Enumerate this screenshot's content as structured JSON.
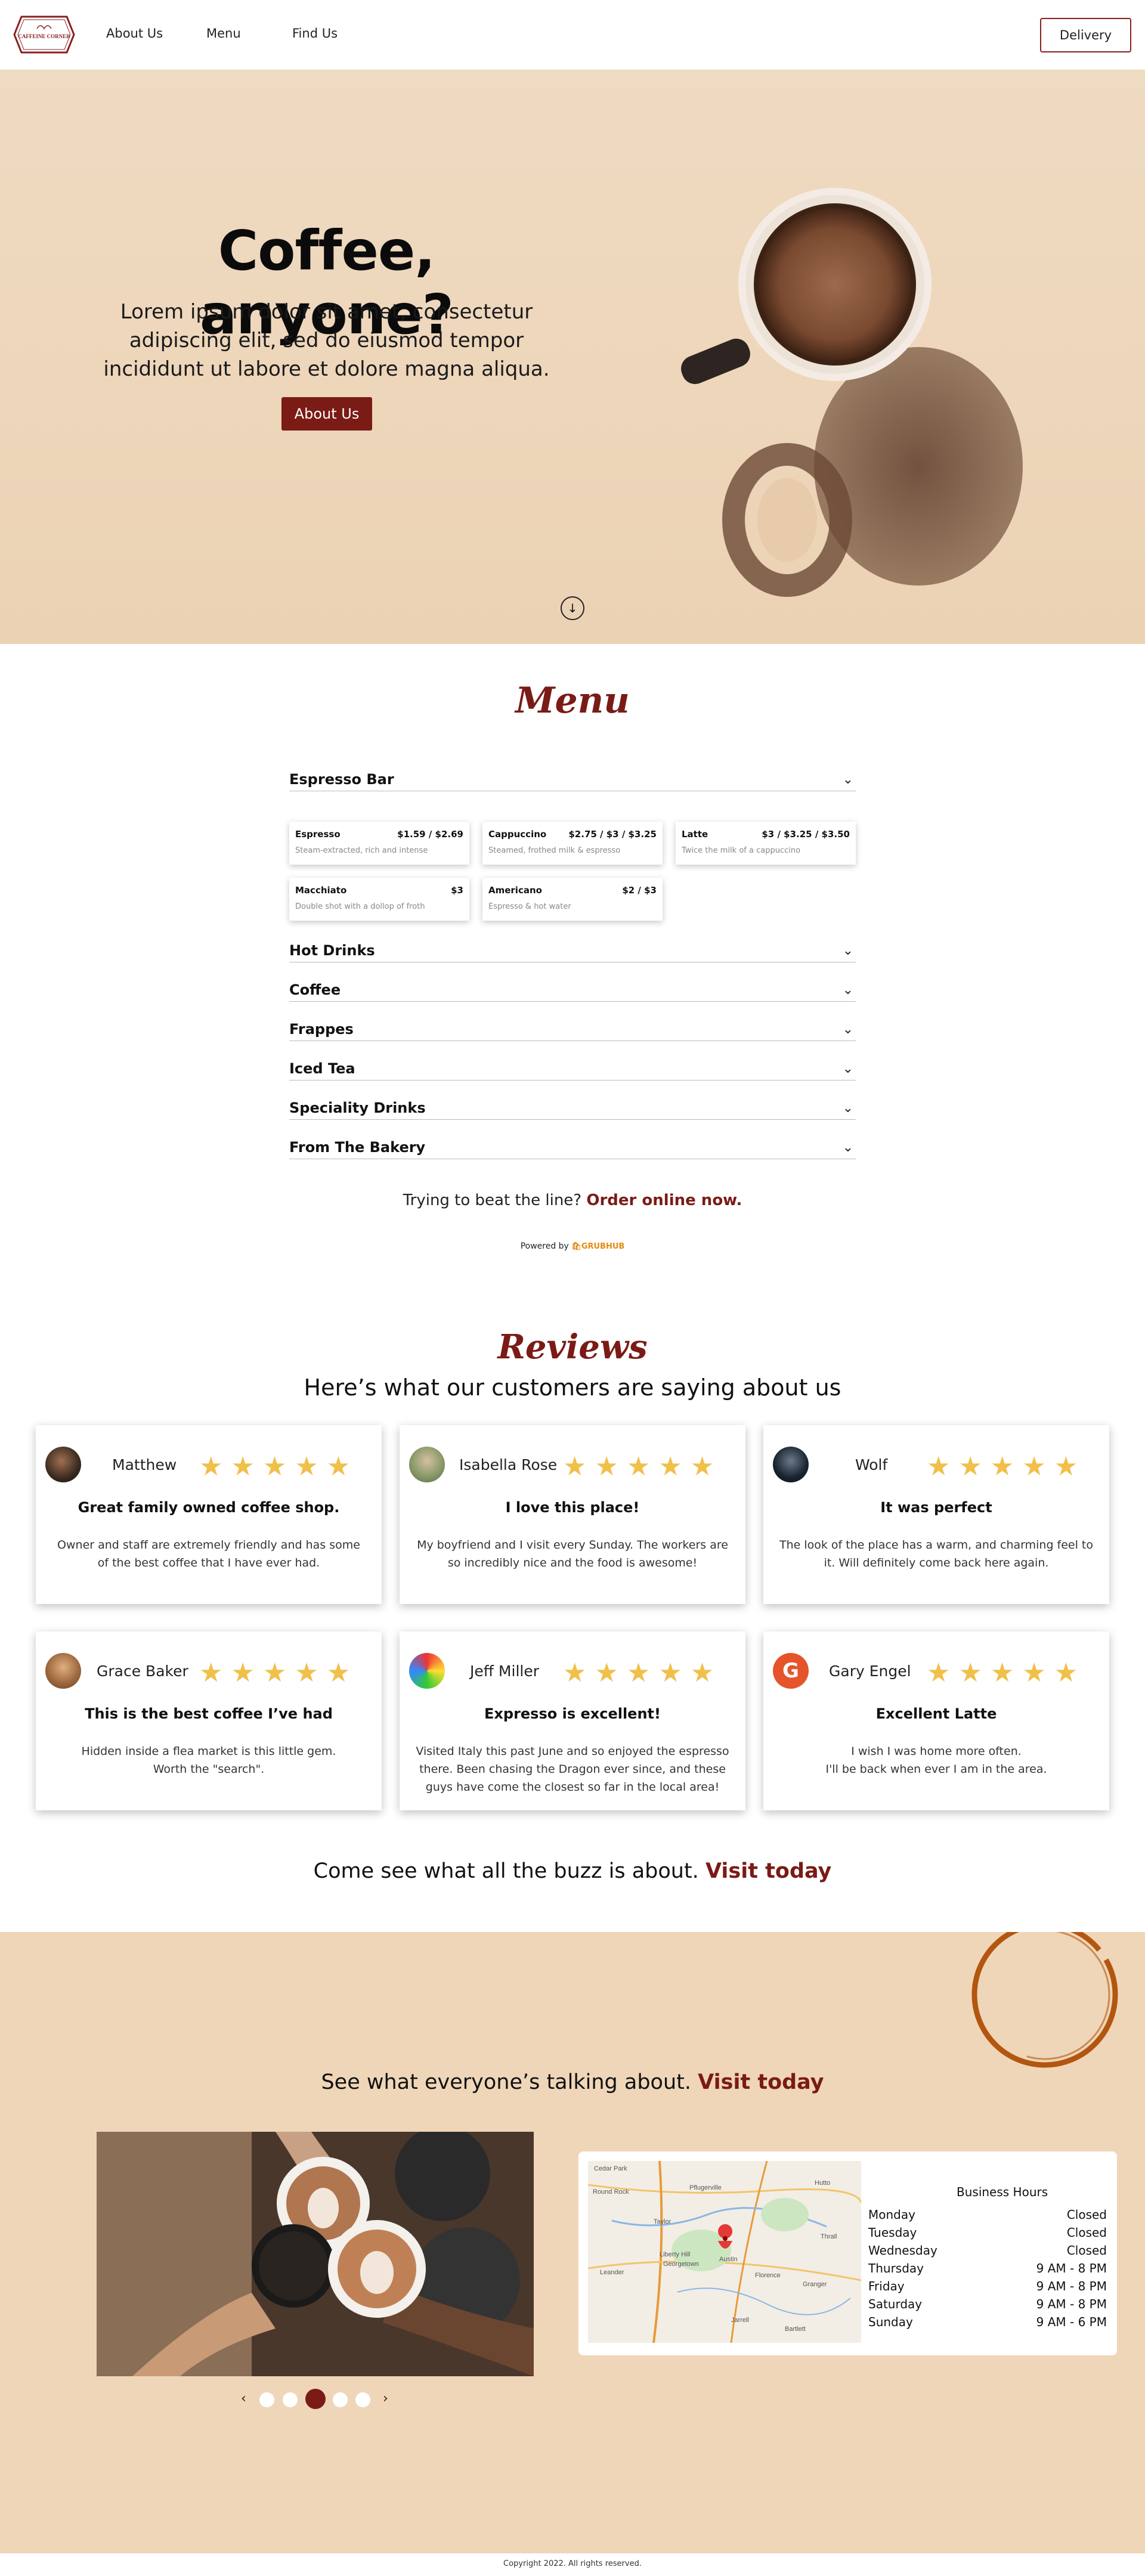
{
  "nav": {
    "logo_text": "CAFFEINE CORNER",
    "links": [
      "About Us",
      "Menu",
      "Find Us"
    ],
    "delivery_label": "Delivery"
  },
  "hero": {
    "title": "Coffee, anyone?",
    "text": "Lorem ipsum dolor sit amet, consectetur adipiscing elit, sed do eiusmod tempor incididunt ut labore et dolore magna aliqua.",
    "button_label": "About Us",
    "scroll_icon": "arrow-down-circle-icon"
  },
  "menu": {
    "title": "Menu",
    "open_category": "Espresso Bar",
    "items": [
      {
        "name": "Espresso",
        "price": "$1.59 / $2.69",
        "desc": "Steam-extracted, rich and intense"
      },
      {
        "name": "Cappuccino",
        "price": "$2.75 / $3 / $3.25",
        "desc": "Steamed, frothed milk & espresso"
      },
      {
        "name": "Latte",
        "price": "$3 / $3.25 / $3.50",
        "desc": "Twice the milk of a cappuccino"
      },
      {
        "name": "Macchiato",
        "price": "$3",
        "desc": "Double shot with a dollop of froth"
      },
      {
        "name": "Americano",
        "price": "$2 / $3",
        "desc": "Espresso & hot water"
      }
    ],
    "categories": [
      "Hot Drinks",
      "Coffee",
      "Frappes",
      "Iced Tea",
      "Speciality Drinks",
      "From The Bakery"
    ],
    "order_text": "Trying to beat the line?",
    "order_link": "Order online now.",
    "powered_text": "Powered by",
    "powered_brand": "GRUBHUB"
  },
  "reviews": {
    "title": "Reviews",
    "subtitle": "Here’s what our customers are saying about us",
    "stars": "★★★★★",
    "items": [
      {
        "name": "Matthew",
        "headline": "Great family owned coffee shop.",
        "body": "Owner and staff are extremely friendly and has some of the best coffee that I have ever had."
      },
      {
        "name": "Isabella Rose",
        "headline": "I love this place!",
        "body": "My boyfriend and I visit every Sunday. The workers are so incredibly nice and the food is awesome!"
      },
      {
        "name": "Wolf",
        "headline": "It was perfect",
        "body": "The look of the place has a warm, and charming feel to it. Will definitely come back here again."
      },
      {
        "name": "Grace Baker",
        "headline": "This is the best coffee I’ve had",
        "body": "Hidden inside a flea market is this little gem.\nWorth the \"search\"."
      },
      {
        "name": "Jeff Miller",
        "headline": "Expresso is excellent!",
        "body": "Visited Italy this past June and so enjoyed the espresso there.  Been chasing the Dragon ever since, and these guys have come the closest so far in the local area!"
      },
      {
        "name": "Gary Engel",
        "avatar_letter": "G",
        "headline": "Excellent Latte",
        "body": "I wish I was home more often.\nI'll be back when ever I am in the area."
      }
    ],
    "buzz_text": "Come see what all the buzz is about.",
    "buzz_link": "Visit today"
  },
  "visit": {
    "title_text": "See what everyone’s talking about.",
    "title_link": "Visit today",
    "carousel": {
      "prev": "‹",
      "next": "›",
      "slides": 5,
      "active_slide": 3
    },
    "map_labels": [
      "Cedar Park",
      "Round Rock",
      "Pflugerville",
      "Hutto",
      "Taylor",
      "Leander",
      "Liberty Hill",
      "Georgetown",
      "Florence",
      "Jarrell",
      "Bartlett",
      "Granger",
      "Thrall",
      "Austin"
    ],
    "hours_title": "Business Hours",
    "hours": [
      {
        "day": "Monday",
        "time": "Closed"
      },
      {
        "day": "Tuesday",
        "time": "Closed"
      },
      {
        "day": "Wednesday",
        "time": "Closed"
      },
      {
        "day": "Thursday",
        "time": "9 AM - 8 PM"
      },
      {
        "day": "Friday",
        "time": "9 AM - 8 PM"
      },
      {
        "day": "Saturday",
        "time": "9 AM - 8 PM"
      },
      {
        "day": "Sunday",
        "time": "9 AM - 6 PM"
      }
    ]
  },
  "footer": {
    "text": "Copyright 2022. All rights reserved."
  },
  "colors": {
    "brand": "#7a1b16",
    "hero_bg": "#eed8bd",
    "visit_bg": "#efd6b8",
    "star": "#f0c04a"
  }
}
